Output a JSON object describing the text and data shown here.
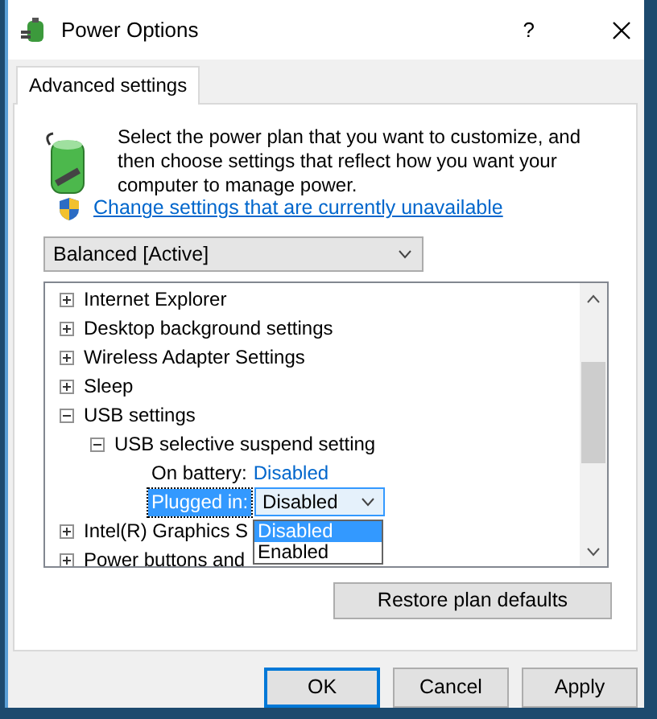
{
  "window": {
    "title": "Power Options",
    "help": "?"
  },
  "tabs": [
    {
      "label": "Advanced settings",
      "selected": true
    }
  ],
  "description": "Select the power plan that you want to customize, and then choose settings that reflect how you want your computer to manage power.",
  "link": "Change settings that are currently unavailable",
  "plan_select": {
    "value": "Balanced [Active]"
  },
  "tree": [
    {
      "label": "Internet Explorer",
      "expanded": false
    },
    {
      "label": "Desktop background settings",
      "expanded": false
    },
    {
      "label": "Wireless Adapter Settings",
      "expanded": false
    },
    {
      "label": "Sleep",
      "expanded": false
    },
    {
      "label": "USB settings",
      "expanded": true,
      "children": [
        {
          "label": "USB selective suspend setting",
          "expanded": true,
          "children": [
            {
              "kind": "value",
              "label": "On battery:",
              "value": "Disabled"
            },
            {
              "kind": "dropdown",
              "label": "Plugged in:",
              "value": "Disabled",
              "options": [
                {
                  "label": "Disabled",
                  "selected": true
                },
                {
                  "label": "Enabled",
                  "selected": false
                }
              ]
            }
          ]
        }
      ]
    },
    {
      "label": "Intel(R) Graphics S",
      "expanded": false
    },
    {
      "label": "Power buttons and",
      "expanded": false
    }
  ],
  "restore_button": "Restore plan defaults",
  "buttons": [
    {
      "label": "OK",
      "default": true
    },
    {
      "label": "Cancel",
      "default": false
    },
    {
      "label": "Apply",
      "default": false
    }
  ]
}
